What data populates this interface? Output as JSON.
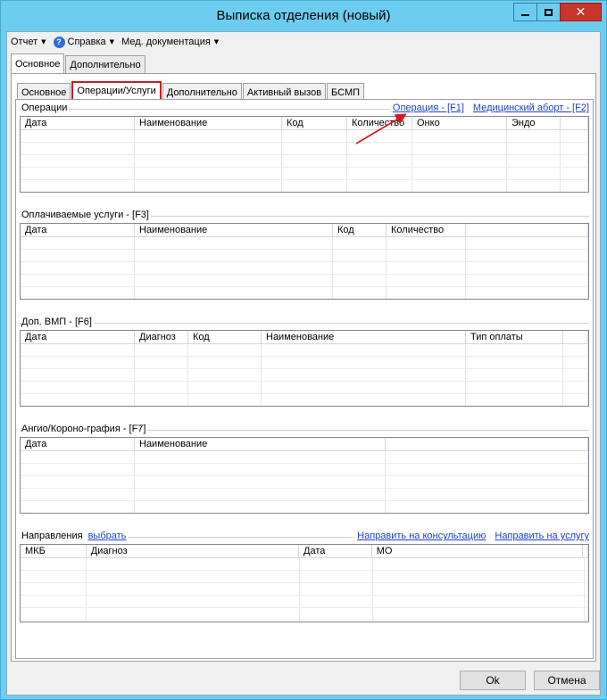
{
  "window": {
    "title": "Выписка отделения (новый)"
  },
  "menu": {
    "report": "Отчет",
    "help": "Справка",
    "med_docs": "Мед. документация"
  },
  "outer_tabs": [
    "Основное",
    "Дополнительно"
  ],
  "inner_tabs": [
    "Основное",
    "Операции/Услуги",
    "Дополнительно",
    "Активный вызов",
    "БСМП"
  ],
  "operations": {
    "title": "Операции",
    "link_operation": "Операция - [F1]",
    "link_abortion": "Медицинский аборт - [F2]",
    "columns": [
      "Дата",
      "Наименование",
      "Код",
      "Количество",
      "Онко",
      "Эндо"
    ]
  },
  "paid": {
    "title": "Оплачиваемые услуги - [F3]",
    "columns": [
      "Дата",
      "Наименование",
      "Код",
      "Количество"
    ]
  },
  "vmp": {
    "title": "Доп. ВМП - [F6]",
    "columns": [
      "Дата",
      "Диагноз",
      "Код",
      "Наименование",
      "Тип оплаты"
    ]
  },
  "angio": {
    "title": "Ангио/Короно-графия - [F7]",
    "columns": [
      "Дата",
      "Наименование"
    ]
  },
  "referrals": {
    "title": "Направления",
    "select_link": "выбрать",
    "link_consult": "Направить на консультацию",
    "link_service": "Направить на услугу",
    "columns": [
      "МКБ",
      "Диагноз",
      "Дата",
      "МО"
    ]
  },
  "buttons": {
    "ok": "Ok",
    "cancel": "Отмена"
  },
  "colors": {
    "window_frame": "#6ccdf0",
    "close_button": "#c7352b",
    "highlight": "#d01c1c",
    "link": "#1a3fd6"
  }
}
